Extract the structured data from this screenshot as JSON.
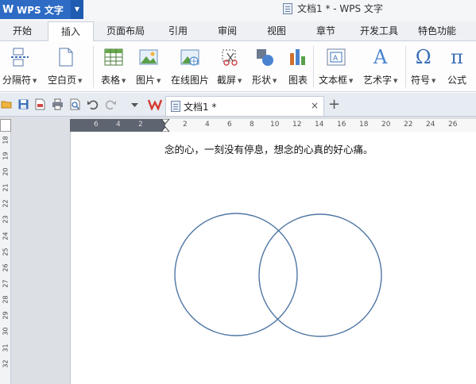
{
  "app": {
    "logo": "W",
    "name": "WPS 文字"
  },
  "window_title": "文档1 * - WPS 文字",
  "menu_tabs": [
    {
      "label": "开始"
    },
    {
      "label": "插入"
    },
    {
      "label": "页面布局"
    },
    {
      "label": "引用"
    },
    {
      "label": "审阅"
    },
    {
      "label": "视图"
    },
    {
      "label": "章节"
    },
    {
      "label": "开发工具"
    },
    {
      "label": "特色功能"
    }
  ],
  "active_tab": "插入",
  "ribbon": {
    "items": [
      {
        "label": "分隔符",
        "icon": "page-break-icon",
        "dropdown": true
      },
      {
        "label": "空白页",
        "icon": "blank-page-icon",
        "dropdown": true
      },
      {
        "label": "表格",
        "icon": "table-icon",
        "dropdown": true
      },
      {
        "label": "图片",
        "icon": "picture-icon",
        "dropdown": true
      },
      {
        "label": "在线图片",
        "icon": "online-picture-icon",
        "dropdown": false
      },
      {
        "label": "截屏",
        "icon": "screenshot-icon",
        "dropdown": true
      },
      {
        "label": "形状",
        "icon": "shapes-icon",
        "dropdown": true
      },
      {
        "label": "图表",
        "icon": "chart-icon",
        "dropdown": false
      },
      {
        "label": "文本框",
        "icon": "textbox-icon",
        "dropdown": true
      },
      {
        "label": "艺术字",
        "icon": "wordart-icon",
        "dropdown": true
      },
      {
        "label": "符号",
        "icon": "symbol-icon",
        "dropdown": true
      },
      {
        "label": "公式",
        "icon": "formula-icon",
        "dropdown": false
      }
    ]
  },
  "ribbon_glyphs": {
    "wordart": "A",
    "symbol": "Ω",
    "formula": "π"
  },
  "document_tab": {
    "label": "文档1 *",
    "close": "×"
  },
  "new_tab_symbol": "+",
  "ruler": {
    "horizontal_left": [
      "6",
      "4",
      "2"
    ],
    "horizontal_right": [
      "2",
      "4",
      "6",
      "8",
      "10",
      "12",
      "14",
      "16",
      "18",
      "20",
      "22",
      "24",
      "26"
    ],
    "vertical": [
      "18",
      "19",
      "20",
      "21",
      "22",
      "23",
      "24",
      "25",
      "26",
      "27",
      "28",
      "29",
      "30",
      "31",
      "32"
    ]
  },
  "document": {
    "text_line": "念的心，一刻没有停息，想念的心真的好心痛。"
  },
  "colors": {
    "app_blue": "#2d6bc4",
    "circle_stroke": "#4f76a3",
    "ribbon_bg": "#fdfdfd",
    "workspace_bg": "#dcdfe4"
  }
}
